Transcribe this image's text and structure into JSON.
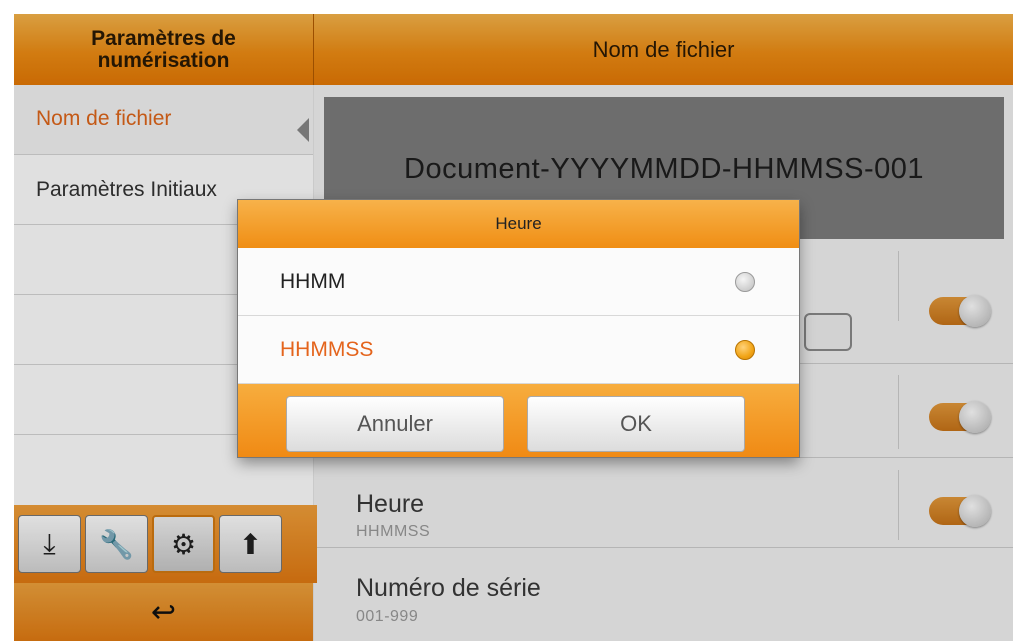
{
  "header": {
    "left_title": "Paramètres de numérisation",
    "right_title": "Nom de fichier"
  },
  "sidebar": {
    "items": [
      {
        "label": "Nom de fichier",
        "active": true
      },
      {
        "label": "Paramètres Initiaux",
        "active": false
      },
      {
        "label": ""
      },
      {
        "label": ""
      },
      {
        "label": ""
      }
    ]
  },
  "main": {
    "preview_name": "Document-YYYYMMDD-HHMMSS-001",
    "rows": [
      {
        "title": "Heure",
        "value": "HHMMSS",
        "toggle": "on"
      },
      {
        "title": "Numéro de série",
        "value": "001-999"
      }
    ]
  },
  "toolbar": {
    "icons": [
      "download-icon",
      "wrench-icon",
      "scanner-settings-icon",
      "upload-settings-icon"
    ],
    "back_icon": "back-arrow-icon"
  },
  "dialog": {
    "title": "Heure",
    "options": [
      {
        "label": "HHMM",
        "selected": false
      },
      {
        "label": "HHMMSS",
        "selected": true
      }
    ],
    "cancel_label": "Annuler",
    "ok_label": "OK"
  },
  "colors": {
    "accent_orange": "#f08e14",
    "selected_text": "#e4641c"
  }
}
